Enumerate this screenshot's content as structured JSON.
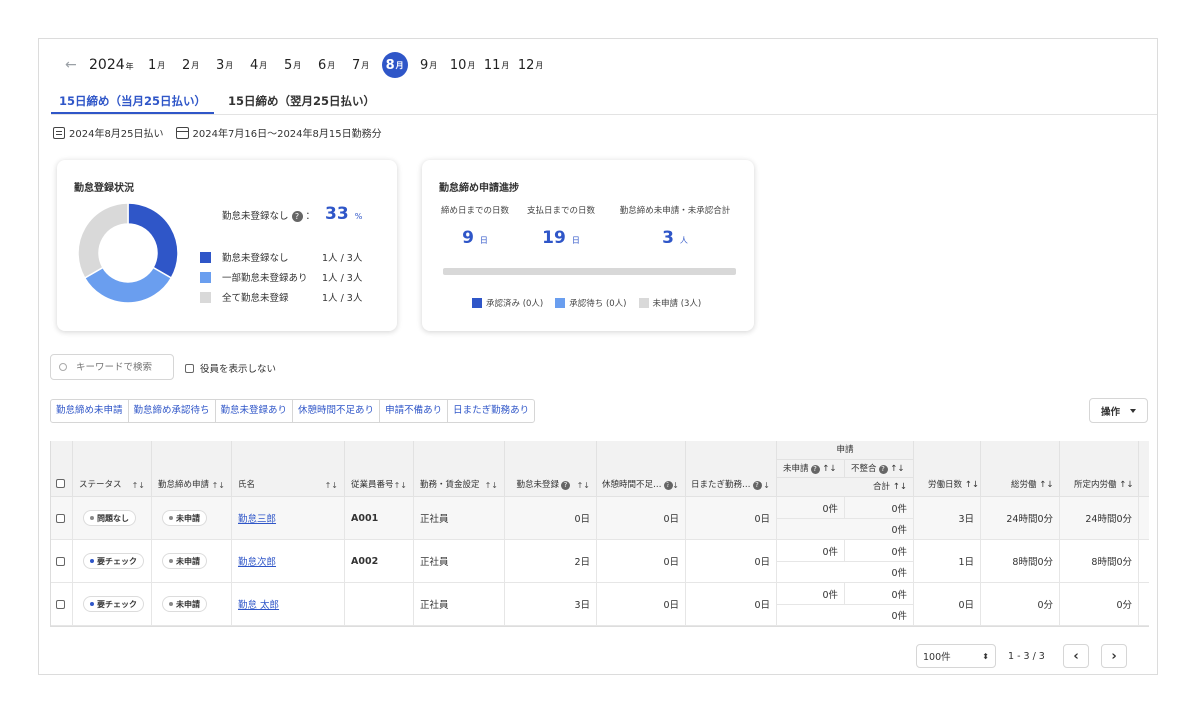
{
  "nav": {
    "prev_arrow": "←",
    "year": "2024",
    "year_suffix": "年",
    "month_suffix": "月",
    "months": [
      "1",
      "2",
      "3",
      "4",
      "5",
      "6",
      "7",
      "8",
      "9",
      "10",
      "11",
      "12"
    ],
    "active_month": "8"
  },
  "tabs": [
    {
      "label": "15日締め（当月25日払い）",
      "active": true
    },
    {
      "label": "15日締め（翌月25日払い）",
      "active": false
    }
  ],
  "meta": {
    "pay_date": "2024年8月25日払い",
    "period": "2024年7月16日〜2024年8月15日勤務分"
  },
  "card_registration": {
    "title": "勤怠登録状況",
    "kpi_label": "勤怠未登録なし",
    "kpi_colon": "：",
    "kpi_value": "33",
    "kpi_unit": "%",
    "items": [
      {
        "label": "勤怠未登録なし",
        "value": "1人 / 3人",
        "color": "#2f56c8"
      },
      {
        "label": "一部勤怠未登録あり",
        "value": "1人 / 3人",
        "color": "#6a9eef"
      },
      {
        "label": "全て勤怠未登録",
        "value": "1人 / 3人",
        "color": "#d9d9d9"
      }
    ],
    "chart_data": {
      "type": "pie",
      "categories": [
        "勤怠未登録なし",
        "一部勤怠未登録あり",
        "全て勤怠未登録"
      ],
      "values": [
        1,
        1,
        1
      ]
    }
  },
  "card_progress": {
    "title": "勤怠締め申請進捗",
    "stats": [
      {
        "label": "締め日までの日数",
        "value": "9",
        "unit": "日"
      },
      {
        "label": "支払日までの日数",
        "value": "19",
        "unit": "日"
      },
      {
        "label": "勤怠締め未申請・未承認合計",
        "value": "3",
        "unit": "人"
      }
    ],
    "progress_fraction": 0,
    "legend": [
      {
        "label": "承認済み (0人)",
        "color": "#2f56c8"
      },
      {
        "label": "承認待ち (0人)",
        "color": "#6a9eef"
      },
      {
        "label": "未申請 (3人)",
        "color": "#d9d9d9"
      }
    ]
  },
  "search": {
    "placeholder": "キーワードで検索"
  },
  "hide_officers": {
    "label": "役員を表示しない",
    "checked": false
  },
  "filters": [
    "勤怠締め未申請",
    "勤怠締め承認待ち",
    "勤怠未登録あり",
    "休憩時間不足あり",
    "申請不備あり",
    "日またぎ勤務あり"
  ],
  "operations": {
    "label": "操作"
  },
  "table": {
    "group_header": "申請",
    "sub_headers": [
      "未申請",
      "不整合",
      "合計"
    ],
    "headers": [
      "ステータス",
      "勤怠締め申請",
      "氏名",
      "従業員番号",
      "勤務・賃金設定",
      "勤怠未登録",
      "休憩時間不足…",
      "日またぎ勤務…",
      "労働日数",
      "総労働",
      "所定内労働"
    ],
    "sort_icon": "↑↓",
    "rows": [
      {
        "status": "問題なし",
        "status_color": "#888888",
        "apply": "未申請",
        "name": "勤怠三郎",
        "emp_no": "A001",
        "setting": "正社員",
        "unregistered": "0日",
        "break": "0日",
        "overnight": "0日",
        "unapplied": "0件",
        "mismatch": "0件",
        "total": "0件",
        "days": "3日",
        "total_work": "24時間0分",
        "scheduled": "24時間0分"
      },
      {
        "status": "要チェック",
        "status_color": "#2f56c8",
        "apply": "未申請",
        "name": "勤怠次郎",
        "emp_no": "A002",
        "setting": "正社員",
        "unregistered": "2日",
        "break": "0日",
        "overnight": "0日",
        "unapplied": "0件",
        "mismatch": "0件",
        "total": "0件",
        "days": "1日",
        "total_work": "8時間0分",
        "scheduled": "8時間0分"
      },
      {
        "status": "要チェック",
        "status_color": "#2f56c8",
        "apply": "未申請",
        "name": "勤怠 太郎",
        "emp_no": "",
        "setting": "正社員",
        "unregistered": "3日",
        "break": "0日",
        "overnight": "0日",
        "unapplied": "0件",
        "mismatch": "0件",
        "total": "0件",
        "days": "0日",
        "total_work": "0分",
        "scheduled": "0分"
      }
    ]
  },
  "pagination": {
    "page_size": "100件",
    "info": "1 - 3 / 3",
    "prev": "‹",
    "next": "›"
  }
}
